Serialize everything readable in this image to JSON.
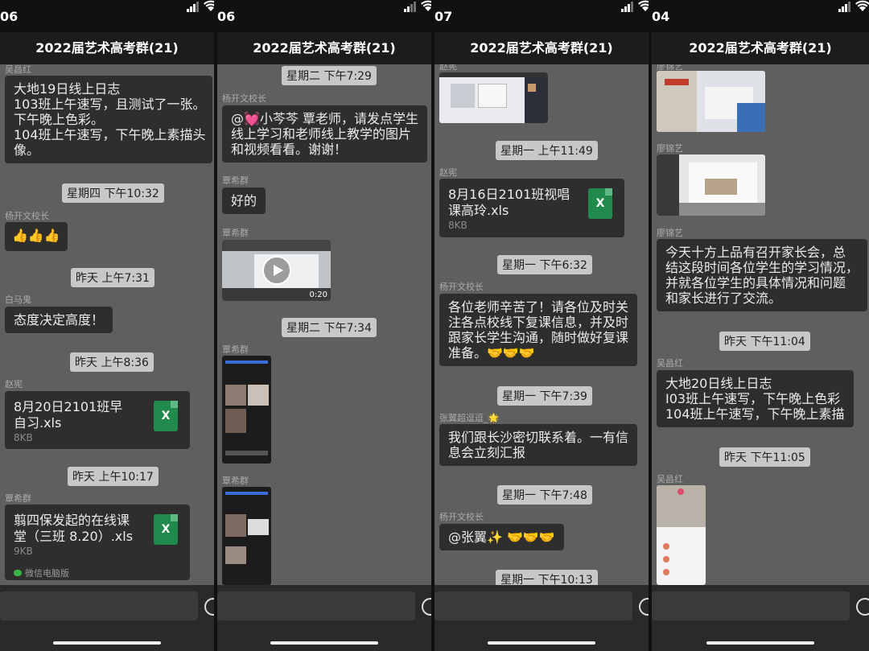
{
  "chat_title": "2022届艺术高考群(21)",
  "panels": [
    {
      "status_time_left": "06",
      "status_time_right": "06",
      "messages": [
        {
          "sender": "吴昌红",
          "lines": [
            "大地19日线上日志",
            "103班上午速写，且测试了一张。",
            "下午晚上色彩。",
            "104班上午速写，下午晚上素描头",
            "像。"
          ]
        },
        {
          "time": "星期四 下午10:32"
        },
        {
          "sender": "杨开文校长",
          "lines": [
            "👍👍👍"
          ]
        },
        {
          "time": "昨天 上午7:31"
        },
        {
          "sender": "白马鬼",
          "lines": [
            "态度决定高度！"
          ]
        },
        {
          "time": "昨天 上午8:36"
        },
        {
          "sender": "赵宪",
          "file": [
            "8月20日2101班早",
            "自习.xls"
          ],
          "size": "8KB"
        },
        {
          "time": "昨天 上午10:17"
        },
        {
          "sender": "覃希群",
          "file": [
            "翦四保发起的在线课",
            "堂（三班 8.20）.xls"
          ],
          "size": "9KB",
          "source": "微信电脑版"
        }
      ]
    },
    {
      "status_time_left": "",
      "status_time_right": "07",
      "messages": [
        {
          "time": "星期二 下午7:29"
        },
        {
          "sender": "杨开文校长",
          "lines": [
            "@💓小芩芩 覃老师，请发点学生",
            "线上学习和老师线上教学的图片",
            "和视频看看。谢谢！"
          ]
        },
        {
          "sender": "覃希群",
          "lines": [
            "好的"
          ]
        },
        {
          "sender": "覃希群",
          "video": "0:20"
        },
        {
          "time": "星期二 下午7:34"
        },
        {
          "sender": "覃希群",
          "image": "screenshot"
        },
        {
          "sender": "覃希群",
          "image": "screenshot"
        }
      ]
    },
    {
      "status_time_left": "",
      "status_time_right": "04",
      "messages": [
        {
          "sender": "赵宪",
          "image": "screenshot"
        },
        {
          "time": "星期一 上午11:49"
        },
        {
          "sender": "赵宪",
          "file": [
            "8月16日2101班视唱",
            "课高玲.xls"
          ],
          "size": "8KB"
        },
        {
          "time": "星期一 下午6:32"
        },
        {
          "sender": "杨开文校长",
          "lines": [
            "各位老师辛苦了！请各位及时关",
            "注各点校线下复课信息，并及时",
            "跟家长学生沟通，随时做好复课",
            "准备。🤝🤝🤝"
          ]
        },
        {
          "time": "星期一 下午7:39"
        },
        {
          "sender": "张翼超逗逗_🌟",
          "lines": [
            "我们跟长沙密切联系着。一有信",
            "息会立刻汇报"
          ]
        },
        {
          "time": "星期一 下午7:48"
        },
        {
          "sender": "杨开文校长",
          "lines": [
            "@张翼✨ 🤝🤝🤝"
          ]
        },
        {
          "time": "星期一 下午10:13"
        }
      ]
    },
    {
      "status_time_left": "",
      "status_time_right": "",
      "messages": [
        {
          "sender": "廖锦艺",
          "image": "photo"
        },
        {
          "sender": "廖锦艺",
          "image": "photo"
        },
        {
          "sender": "廖锦艺",
          "lines": [
            "今天十方上品有召开家长会，总",
            "结这段时间各位学生的学习情况，",
            "并就各位学生的具体情况和问题",
            "和家长进行了交流。"
          ]
        },
        {
          "time": "昨天 下午11:04"
        },
        {
          "sender": "吴昌红",
          "lines": [
            "大地20日线上日志",
            "I03班上午速写，下午晚上色彩",
            "104班上午速写，下午晚上素描"
          ]
        },
        {
          "time": "昨天 下午11:05"
        },
        {
          "sender": "吴昌红",
          "image": "screenshot"
        }
      ]
    }
  ]
}
